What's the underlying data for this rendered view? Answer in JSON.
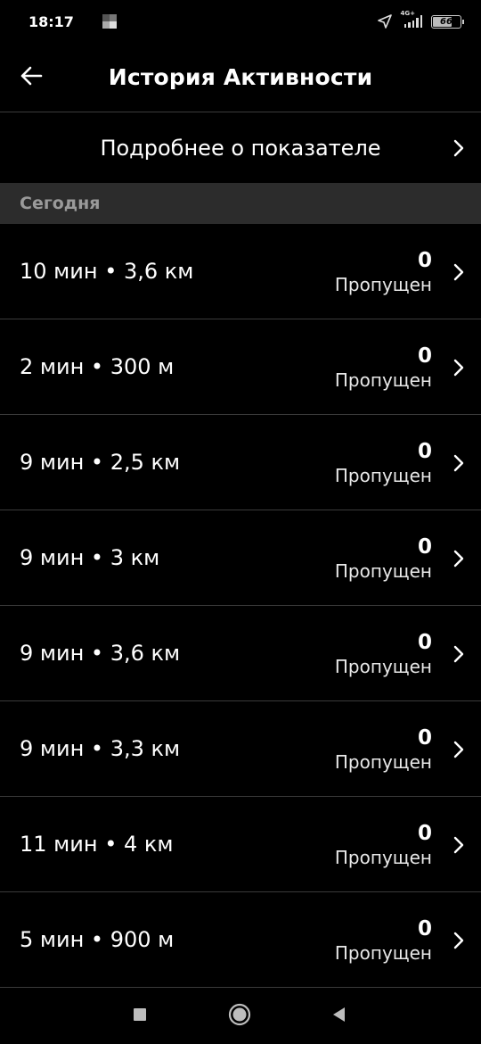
{
  "status_bar": {
    "time": "18:17",
    "network": "4G+",
    "battery": "66",
    "icons": [
      "notification-icon",
      "location-arrow-icon",
      "signal-icon",
      "battery-icon"
    ]
  },
  "header": {
    "title": "История Активности",
    "back_icon": "arrow-left-icon"
  },
  "info_row": {
    "label": "Подробнее о показателе",
    "icon": "chevron-right-icon"
  },
  "section": {
    "label": "Сегодня"
  },
  "activities": [
    {
      "label": "10 мин • 3,6 км",
      "score": "0",
      "status": "Пропущен"
    },
    {
      "label": "2 мин • 300 м",
      "score": "0",
      "status": "Пропущен"
    },
    {
      "label": "9 мин • 2,5 км",
      "score": "0",
      "status": "Пропущен"
    },
    {
      "label": "9 мин • 3 км",
      "score": "0",
      "status": "Пропущен"
    },
    {
      "label": "9 мин • 3,6 км",
      "score": "0",
      "status": "Пропущен"
    },
    {
      "label": "9 мин • 3,3 км",
      "score": "0",
      "status": "Пропущен"
    },
    {
      "label": "11 мин • 4 км",
      "score": "0",
      "status": "Пропущен"
    },
    {
      "label": "5 мин • 900 м",
      "score": "0",
      "status": "Пропущен"
    }
  ],
  "nav_bar": {
    "icons": [
      "recents-square-icon",
      "home-circle-icon",
      "back-triangle-icon"
    ]
  },
  "colors": {
    "background": "#000000",
    "section_bg": "#2c2c2c",
    "divider": "#3a3a3a",
    "section_text": "#9a9a9a"
  }
}
